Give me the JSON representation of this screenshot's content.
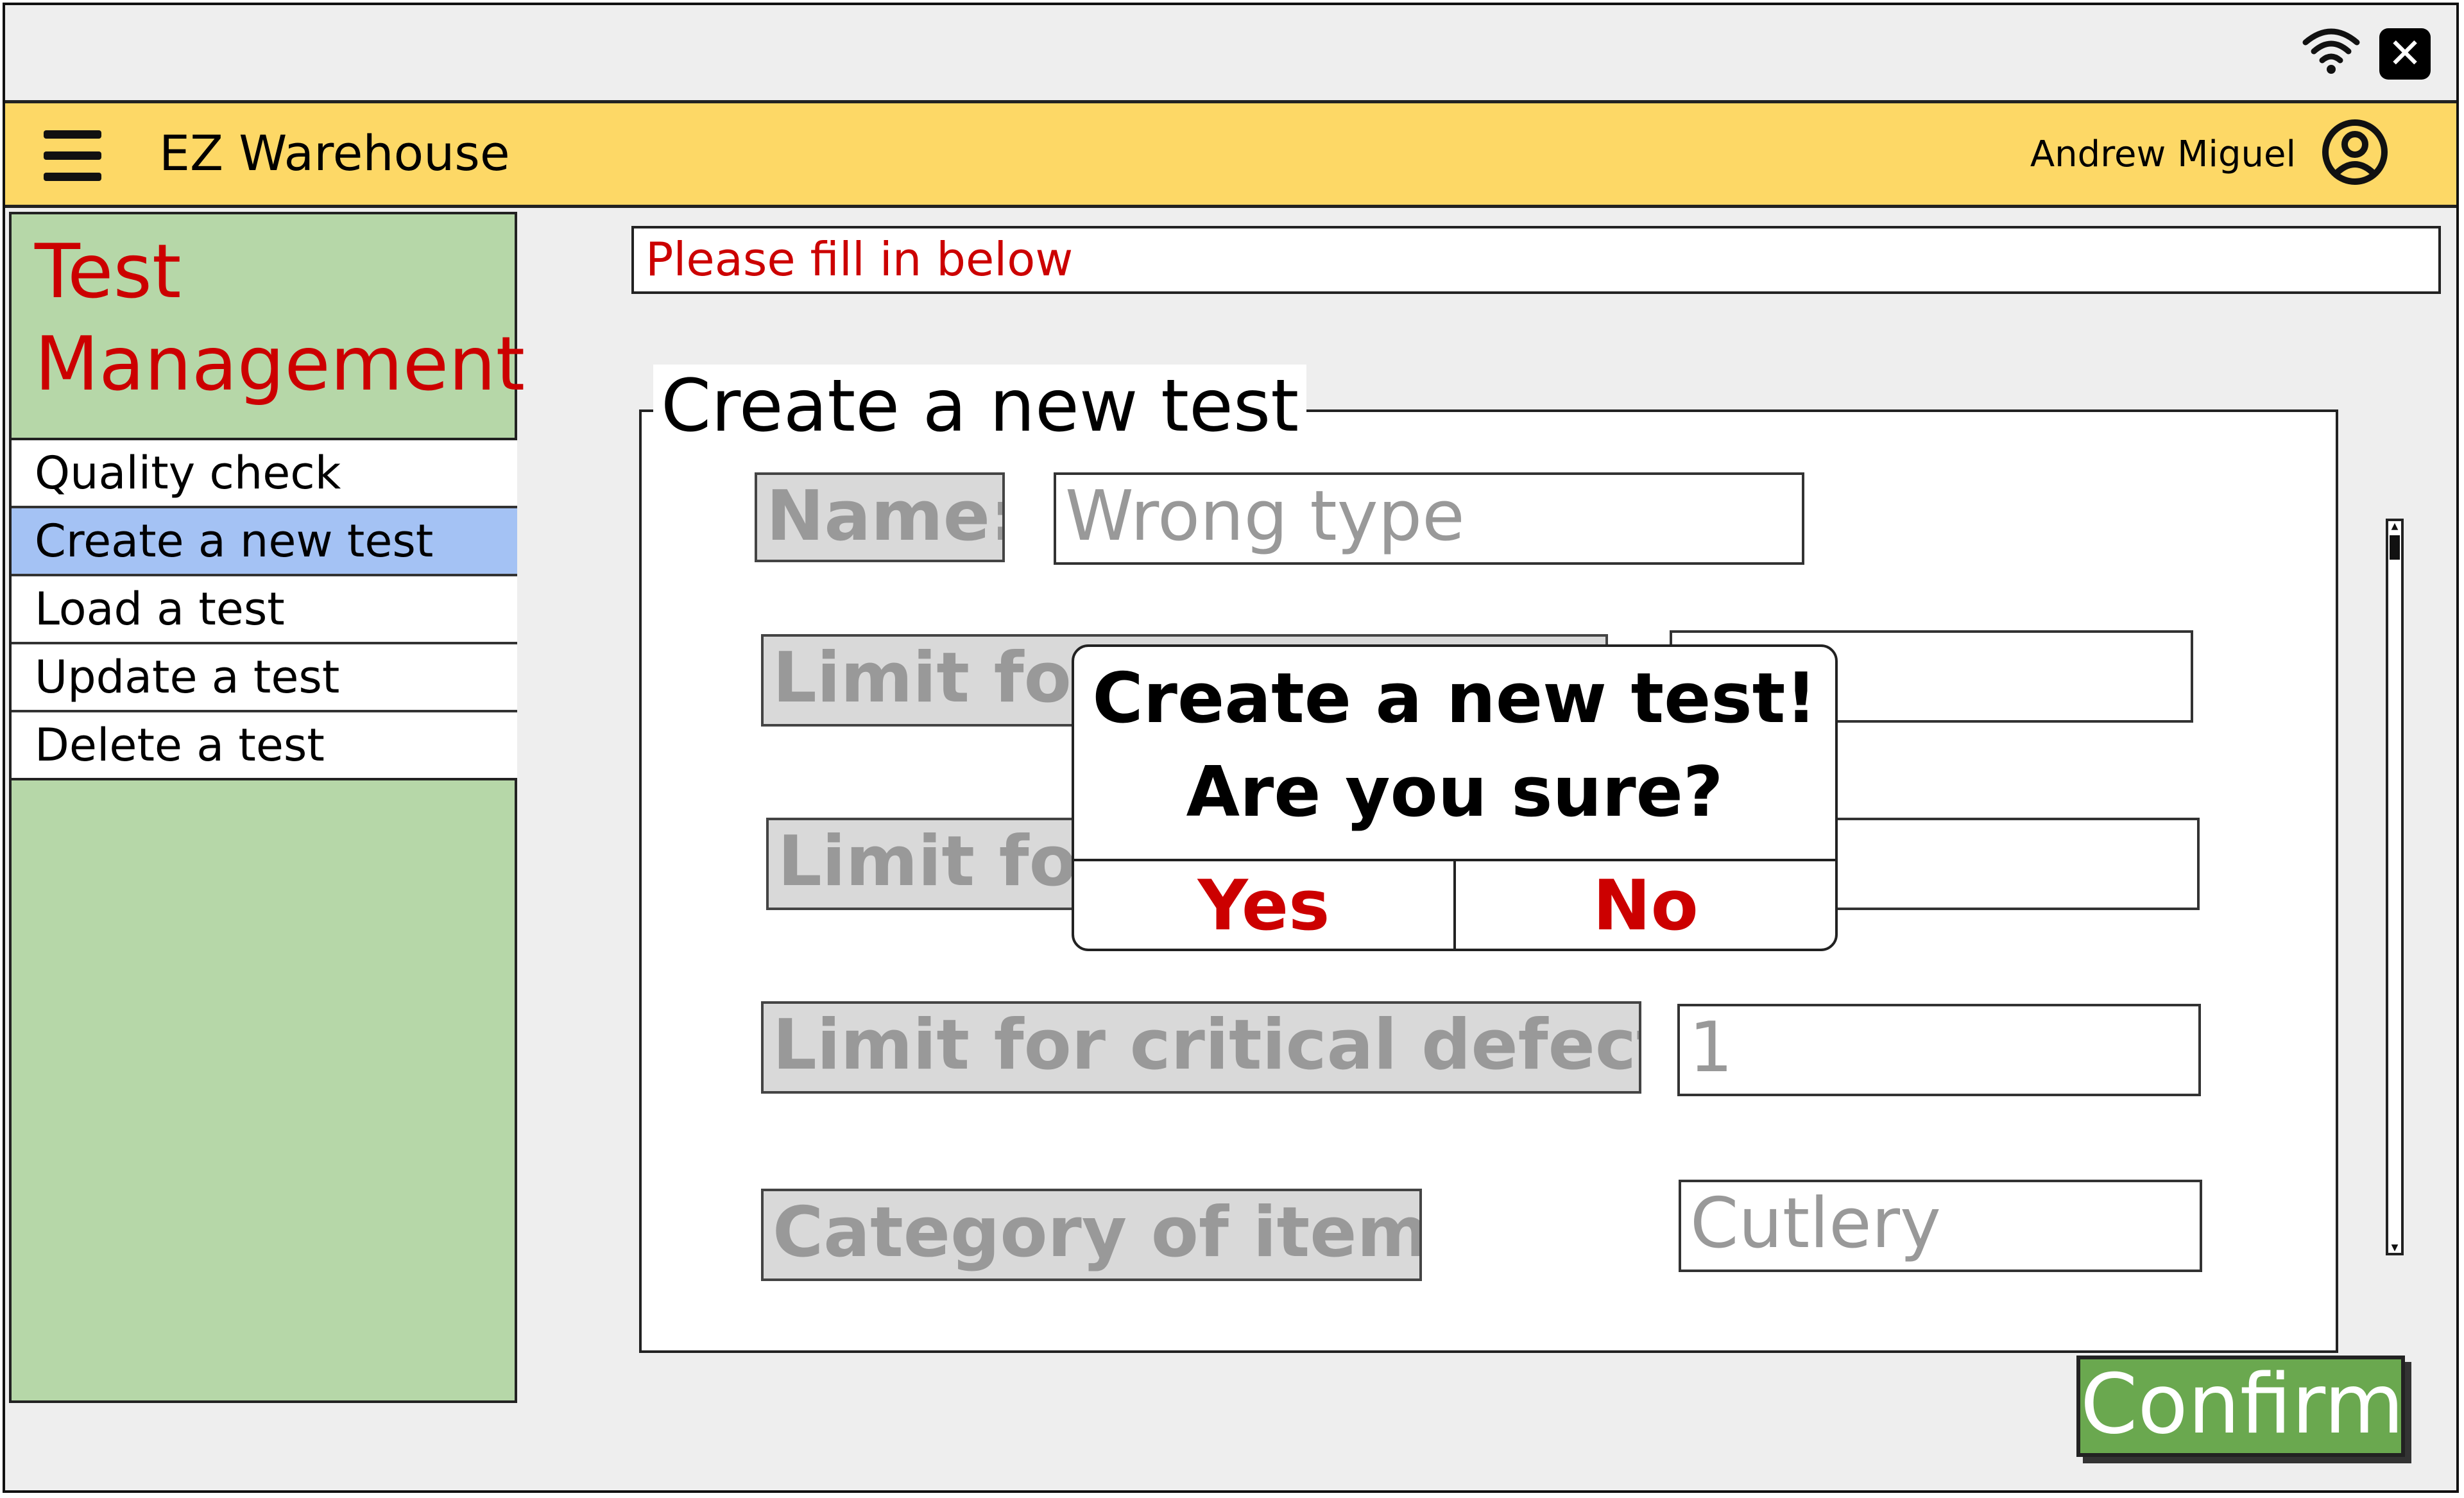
{
  "window": {
    "close_glyph": "✕",
    "icons": [
      "wifi-icon",
      "close-icon"
    ]
  },
  "appbar": {
    "title": "EZ Warehouse",
    "user_name": "Andrew Miguel",
    "accent_color": "#fdd866"
  },
  "sidebar": {
    "title_line1": "Test",
    "title_line2": "Management",
    "title_color": "#cc0000",
    "background": "#b6d7a8",
    "items": [
      {
        "label": "Quality check"
      },
      {
        "label": "Create a new test",
        "selected": true
      },
      {
        "label": "Load a test"
      },
      {
        "label": "Update a test"
      },
      {
        "label": "Delete a test"
      }
    ]
  },
  "banner": {
    "message": "Please fill in below"
  },
  "form": {
    "legend": "Create a new test",
    "name_label": "Name:",
    "name_value": "Wrong type",
    "limit1_label": "Limit for",
    "limit1_value": "",
    "limit2_label": "Limit for",
    "limit2_value": "",
    "critical_label": "Limit for critical defects:",
    "critical_value": "1",
    "category_label": "Category of items:",
    "category_value": "Cutlery"
  },
  "dialog": {
    "line1": "Create a new test!",
    "line2": "Are you sure?",
    "yes_label": "Yes",
    "no_label": "No"
  },
  "actions": {
    "confirm_label": "Confirm",
    "confirm_color": "#6aa84f"
  }
}
